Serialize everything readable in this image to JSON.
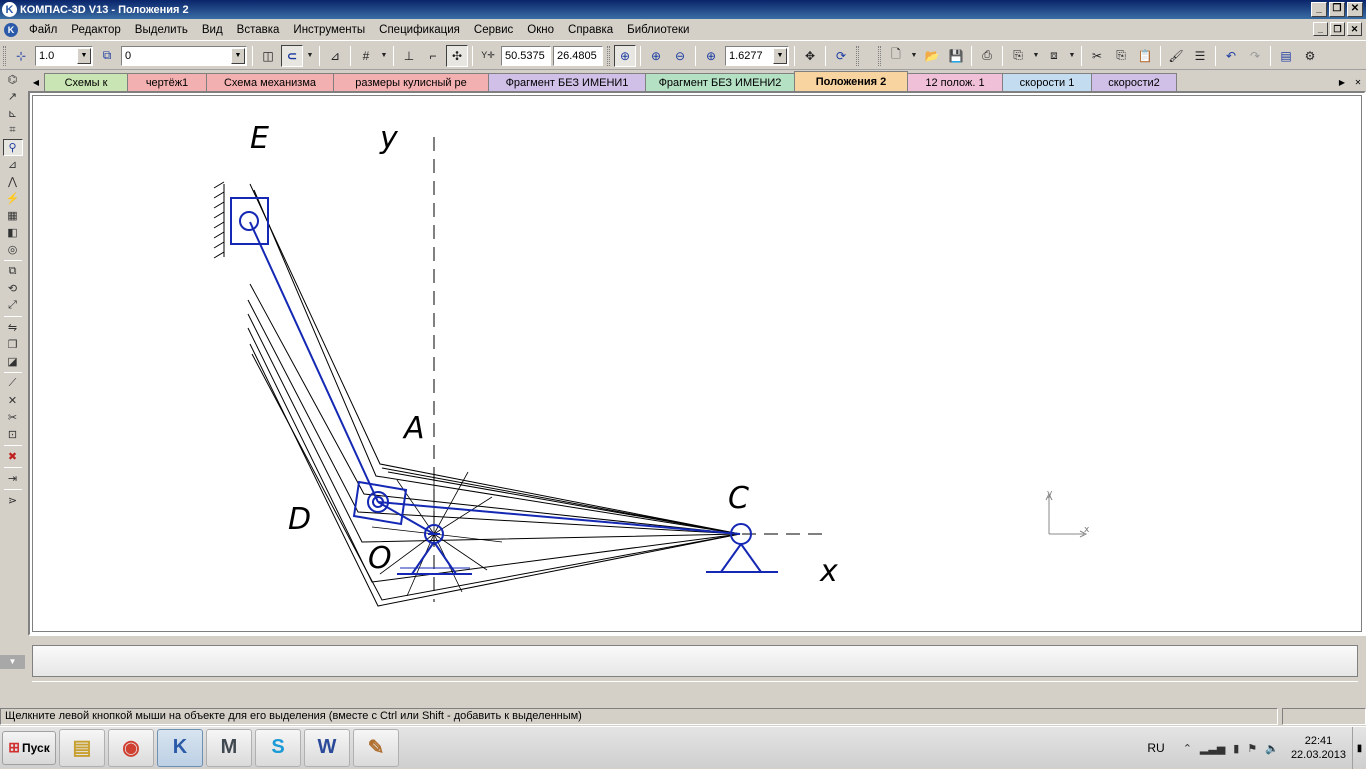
{
  "window": {
    "app_icon_glyph": "K",
    "title": "КОМПАС-3D V13 - Положения 2",
    "minimize_icon": "minimize-icon",
    "restore_icon": "restore-icon",
    "close_icon": "close-icon"
  },
  "menu": {
    "items": [
      "Файл",
      "Редактор",
      "Выделить",
      "Вид",
      "Вставка",
      "Инструменты",
      "Спецификация",
      "Сервис",
      "Окно",
      "Справка",
      "Библиотеки"
    ]
  },
  "toolbar": {
    "scale_value": "1.0",
    "layer_value": "0",
    "coord_x": "50.5375",
    "coord_y": "26.4805",
    "zoom_value": "1.6277"
  },
  "tabs": {
    "items": [
      {
        "label": "Схемы к",
        "color": "#c9e5b3"
      },
      {
        "label": "чертёж1",
        "color": "#f3b0b0"
      },
      {
        "label": "Схема механизма",
        "color": "#f3b0b0"
      },
      {
        "label": "размеры кулисный ре",
        "color": "#f3b0b0"
      },
      {
        "label": "Фрагмент БЕЗ ИМЕНИ1",
        "color": "#d0c0e8"
      },
      {
        "label": "Фрагмент БЕЗ ИМЕНИ2",
        "color": "#b4e0c4"
      },
      {
        "label": "Положения 2",
        "color": "#f8d4a0"
      },
      {
        "label": "12 полож. 1",
        "color": "#f0c0d8"
      },
      {
        "label": "скорости 1",
        "color": "#c4dcf0"
      },
      {
        "label": "скорости2",
        "color": "#d0c0e8"
      }
    ],
    "active_index": 6
  },
  "drawing": {
    "labels": {
      "E": "E",
      "y": "y",
      "A": "A",
      "C": "C",
      "D": "D",
      "O": "O",
      "x": "x"
    },
    "mini_axis_y": "y",
    "mini_axis_x": "x",
    "line_color_blue": "#1428b4",
    "line_color_black": "#000000"
  },
  "status": {
    "message": "Щелкните левой кнопкой мыши на объекте для его выделения (вместе с Ctrl или Shift - добавить к выделенным)"
  },
  "taskbar": {
    "start_label": "Пуск",
    "apps": [
      {
        "name": "explorer",
        "glyph": "▤"
      },
      {
        "name": "chrome",
        "glyph": "◉"
      },
      {
        "name": "kompas",
        "glyph": "K"
      },
      {
        "name": "mathcad",
        "glyph": "M"
      },
      {
        "name": "skype",
        "glyph": "S"
      },
      {
        "name": "word",
        "glyph": "W"
      },
      {
        "name": "paint",
        "glyph": "✎"
      }
    ],
    "lang": "RU",
    "time": "22:41",
    "date": "22.03.2013"
  }
}
